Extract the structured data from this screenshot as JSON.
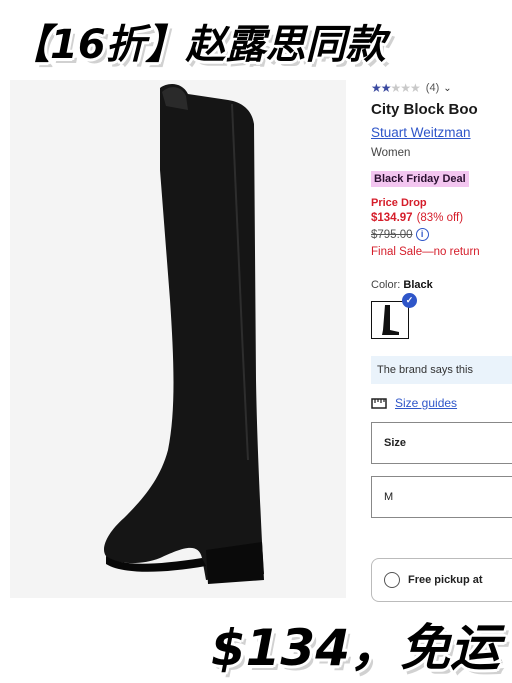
{
  "overlay": {
    "title": "【16折】赵露思同款",
    "bottom": "$134，免运"
  },
  "product": {
    "rating_stars": 2.5,
    "review_count": "(4)",
    "title": "City Block Boo",
    "brand": "Stuart Weitzman",
    "gender": "Women",
    "deal_badge": "Black Friday Deal",
    "price_drop_label": "Price Drop",
    "sale_price": "$134.97",
    "discount": "(83% off)",
    "original_price": "$795.00",
    "final_sale": "Final Sale—no return",
    "color_label": "Color:",
    "color_value": "Black",
    "brand_says": "The brand says this",
    "size_guides": "Size guides",
    "size_select_label": "Size",
    "size_select_value": "M",
    "pickup_label": "Free pickup at"
  },
  "icons": {
    "stars": "star-icon",
    "chevron": "chevron-down-icon",
    "info": "info-icon",
    "check": "check-icon",
    "ruler": "ruler-icon",
    "radio": "radio-icon"
  },
  "colors": {
    "accent_blue": "#2f56c9",
    "sale_red": "#d51d2a",
    "deal_pink": "#f3c6f0",
    "info_bg": "#eaf3fb"
  }
}
